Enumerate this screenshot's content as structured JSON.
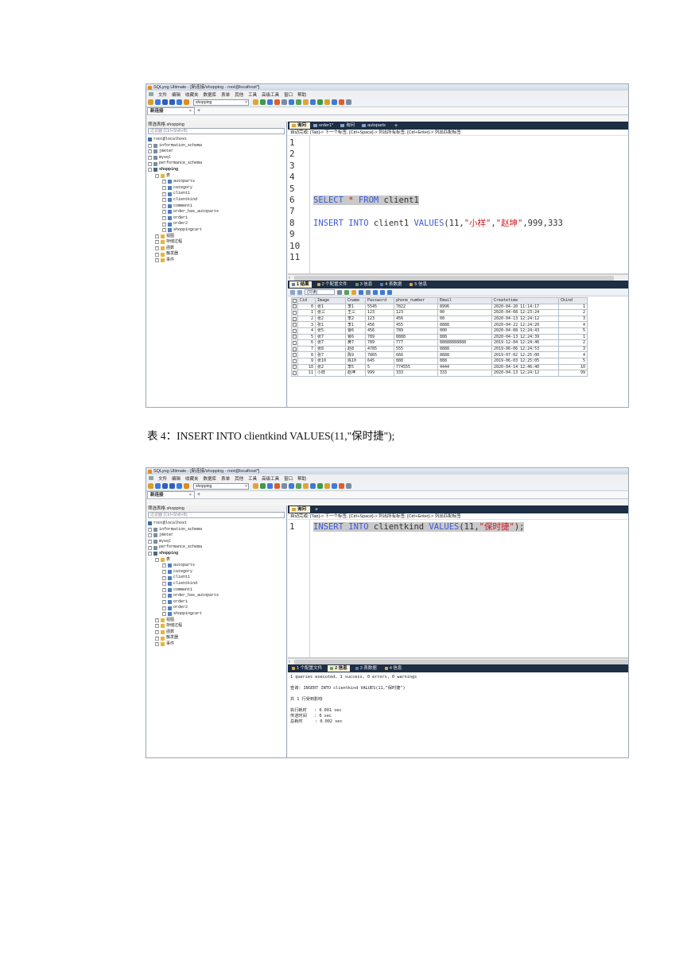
{
  "screens": [
    {
      "window_title": "SQLyog Ultimate - [新连接/shopping - root@localhost*]",
      "menu": [
        "文件",
        "编辑",
        "收藏夹",
        "数据库",
        "表单",
        "其他",
        "工具",
        "高级工具",
        "窗口",
        "帮助"
      ],
      "db_select": "shopping",
      "connection_tab": "新连接",
      "filter_label": "筛选表格 shopping",
      "filter_placeholder": "过滤器 (Ctrl+Shift+B)",
      "tree": [
        {
          "label": "root@localhost",
          "icon": "server-icon",
          "level": 0,
          "exp": ""
        },
        {
          "label": "information_schema",
          "icon": "database-icon",
          "level": 0,
          "exp": "+"
        },
        {
          "label": "jmeter",
          "icon": "database-icon",
          "level": 0,
          "exp": "+"
        },
        {
          "label": "mysql",
          "icon": "database-icon",
          "level": 0,
          "exp": "+"
        },
        {
          "label": "performance_schema",
          "icon": "database-icon",
          "level": 0,
          "exp": "+"
        },
        {
          "label": "shopping",
          "icon": "database-icon",
          "level": 0,
          "exp": "-",
          "bold": true
        },
        {
          "label": "表",
          "icon": "folder-icon",
          "level": 1,
          "exp": "-"
        },
        {
          "label": "autoparts",
          "icon": "table-icon",
          "level": 2,
          "exp": "+"
        },
        {
          "label": "category",
          "icon": "table-icon",
          "level": 2,
          "exp": "+"
        },
        {
          "label": "client1",
          "icon": "table-icon",
          "level": 2,
          "exp": "+"
        },
        {
          "label": "clientkind",
          "icon": "table-icon",
          "level": 2,
          "exp": "+"
        },
        {
          "label": "comment1",
          "icon": "table-icon",
          "level": 2,
          "exp": "+"
        },
        {
          "label": "order_has_autoparts",
          "icon": "table-icon",
          "level": 2,
          "exp": "+"
        },
        {
          "label": "order1",
          "icon": "table-icon",
          "level": 2,
          "exp": "+"
        },
        {
          "label": "order2",
          "icon": "table-icon",
          "level": 2,
          "exp": "+"
        },
        {
          "label": "shoppingcart",
          "icon": "table-icon",
          "level": 2,
          "exp": "+"
        },
        {
          "label": "视图",
          "icon": "folder-icon",
          "level": 1,
          "exp": "+"
        },
        {
          "label": "存储过程",
          "icon": "folder-icon",
          "level": 1,
          "exp": "+"
        },
        {
          "label": "函数",
          "icon": "folder-icon",
          "level": 1,
          "exp": "+"
        },
        {
          "label": "触发器",
          "icon": "folder-icon",
          "level": 1,
          "exp": "+"
        },
        {
          "label": "事件",
          "icon": "folder-icon",
          "level": 1,
          "exp": "+"
        }
      ],
      "query_tabs": [
        {
          "label": "询问",
          "active": true
        },
        {
          "label": "order1*",
          "active": false
        },
        {
          "label": "询问",
          "active": false
        },
        {
          "label": "autoparts",
          "active": false
        }
      ],
      "autocomplete_hint": "自动完成: [Tab]-> 下一个标签, [Ctrl+Space]-> 列出所有标签, [Ctrl+Enter]-> 列出匹配标签",
      "editor_lines": [
        {
          "n": "1",
          "tokens": []
        },
        {
          "n": "2",
          "tokens": []
        },
        {
          "n": "3",
          "tokens": []
        },
        {
          "n": "4",
          "tokens": []
        },
        {
          "n": "5",
          "tokens": []
        },
        {
          "n": "6",
          "tokens": [
            {
              "t": "SELECT",
              "c": "kw",
              "s": true
            },
            {
              "t": " ",
              "c": "plain",
              "s": true
            },
            {
              "t": "*",
              "c": "str",
              "s": true
            },
            {
              "t": " ",
              "c": "plain",
              "s": true
            },
            {
              "t": "FROM",
              "c": "kw",
              "s": true
            },
            {
              "t": " client1",
              "c": "plain",
              "s": true
            }
          ]
        },
        {
          "n": "7",
          "tokens": []
        },
        {
          "n": "8",
          "tokens": [
            {
              "t": "INSERT",
              "c": "kw"
            },
            {
              "t": " ",
              "c": "plain"
            },
            {
              "t": "INTO",
              "c": "kw"
            },
            {
              "t": " client1 ",
              "c": "plain"
            },
            {
              "t": "VALUES",
              "c": "kw"
            },
            {
              "t": "(11,",
              "c": "plain"
            },
            {
              "t": "\"小样\"",
              "c": "str"
            },
            {
              "t": ",",
              "c": "plain"
            },
            {
              "t": "\"赵坤\"",
              "c": "str"
            },
            {
              "t": ",999,333",
              "c": "plain"
            }
          ]
        },
        {
          "n": "9",
          "tokens": []
        },
        {
          "n": "10",
          "tokens": []
        },
        {
          "n": "11",
          "tokens": []
        }
      ],
      "result_tabs": [
        {
          "label": "1 结果",
          "active": true,
          "color": "#4f7fbf"
        },
        {
          "label": "2 个配置文件",
          "active": false,
          "color": "#e0a43a"
        },
        {
          "label": "3 信息",
          "active": false,
          "color": "#5aa05a"
        },
        {
          "label": "4 表数据",
          "active": false,
          "color": "#4f7fbf"
        },
        {
          "label": "5 信息",
          "active": false,
          "color": "#e0a43a"
        }
      ],
      "grid_select": "(只读)",
      "columns": [
        "Cid",
        "Image",
        "Cname",
        "Password",
        "phone_number",
        "Email",
        "Createtime",
        "Ckind"
      ],
      "rows": [
        [
          "0",
          "张1",
          "李1",
          "5545",
          "7822",
          "8996",
          "2020-04-20 11:14:17",
          "1"
        ],
        [
          "1",
          "张三",
          "王三",
          "123",
          "123",
          "00",
          "2020-04-08 12:23:24",
          "2"
        ],
        [
          "2",
          "张2",
          "李2",
          "123",
          "456",
          "00",
          "2020-04-13 12:24:12",
          "3"
        ],
        [
          "3",
          "张1",
          "李1",
          "456",
          "455",
          "8888",
          "2020-04-22 12:24:20",
          "4"
        ],
        [
          "4",
          "张5",
          "曹6",
          "456",
          "789",
          "000",
          "2020-04-08 12:24:43",
          "5"
        ],
        [
          "5",
          "张7",
          "曹6",
          "789",
          "8888",
          "888",
          "2020-04-13 12:24:39",
          "1"
        ],
        [
          "6",
          "张7",
          "黄7",
          "789",
          "777",
          "88888888888",
          "2019-12-04 12:24:46",
          "2"
        ],
        [
          "7",
          "张8",
          "赵8",
          "4785",
          "555",
          "8888",
          "2019-06-06 12:24:53",
          "3"
        ],
        [
          "8",
          "张7",
          "陈9",
          "7865",
          "666",
          "8888",
          "2019-07-02 12:25:00",
          "4"
        ],
        [
          "9",
          "张10",
          "陈10",
          "645",
          "888",
          "888",
          "2019-06-03 12:25:05",
          "5"
        ],
        [
          "10",
          "张2",
          "李5",
          "5",
          "774555",
          "4444",
          "2020-04-14 12:46:40",
          "10"
        ],
        [
          "11",
          "小样",
          "赵坤",
          "999",
          "333",
          "333",
          "2020-04-13 12:24:12",
          "99"
        ]
      ]
    },
    {
      "window_title": "SQLyog Ultimate - [新连接/shopping - root@localhost*]",
      "menu": [
        "文件",
        "编辑",
        "收藏夹",
        "数据库",
        "表单",
        "其他",
        "工具",
        "高级工具",
        "窗口",
        "帮助"
      ],
      "db_select": "shopping",
      "connection_tab": "新连接",
      "filter_label": "筛选表格 shopping",
      "filter_placeholder": "过滤器 (Ctrl+Shift+B)",
      "tree": [
        {
          "label": "root@localhost",
          "icon": "server-icon",
          "level": 0,
          "exp": ""
        },
        {
          "label": "information_schema",
          "icon": "database-icon",
          "level": 0,
          "exp": "+"
        },
        {
          "label": "jmeter",
          "icon": "database-icon",
          "level": 0,
          "exp": "+"
        },
        {
          "label": "mysql",
          "icon": "database-icon",
          "level": 0,
          "exp": "+"
        },
        {
          "label": "performance_schema",
          "icon": "database-icon",
          "level": 0,
          "exp": "+"
        },
        {
          "label": "shopping",
          "icon": "database-icon",
          "level": 0,
          "exp": "-",
          "bold": true
        },
        {
          "label": "表",
          "icon": "folder-icon",
          "level": 1,
          "exp": "-"
        },
        {
          "label": "autoparts",
          "icon": "table-icon",
          "level": 2,
          "exp": "+"
        },
        {
          "label": "category",
          "icon": "table-icon",
          "level": 2,
          "exp": "+"
        },
        {
          "label": "client1",
          "icon": "table-icon",
          "level": 2,
          "exp": "+"
        },
        {
          "label": "clientkind",
          "icon": "table-icon",
          "level": 2,
          "exp": "+"
        },
        {
          "label": "comment1",
          "icon": "table-icon",
          "level": 2,
          "exp": "+"
        },
        {
          "label": "order_has_autoparts",
          "icon": "table-icon",
          "level": 2,
          "exp": "+"
        },
        {
          "label": "order1",
          "icon": "table-icon",
          "level": 2,
          "exp": "+"
        },
        {
          "label": "order2",
          "icon": "table-icon",
          "level": 2,
          "exp": "+"
        },
        {
          "label": "shoppingcart",
          "icon": "table-icon",
          "level": 2,
          "exp": "+"
        },
        {
          "label": "视图",
          "icon": "folder-icon",
          "level": 1,
          "exp": "+"
        },
        {
          "label": "存储过程",
          "icon": "folder-icon",
          "level": 1,
          "exp": "+"
        },
        {
          "label": "函数",
          "icon": "folder-icon",
          "level": 1,
          "exp": "+"
        },
        {
          "label": "触发器",
          "icon": "folder-icon",
          "level": 1,
          "exp": "+"
        },
        {
          "label": "事件",
          "icon": "folder-icon",
          "level": 1,
          "exp": "+"
        }
      ],
      "query_tabs": [
        {
          "label": "询问",
          "active": true
        }
      ],
      "autocomplete_hint": "自动完成: [Tab]-> 下一个标签, [Ctrl+Space]-> 列出所有标签, [Ctrl+Enter]-> 列出匹配标签",
      "editor_lines": [
        {
          "n": "1",
          "tokens": [
            {
              "t": "INSERT",
              "c": "kw",
              "s": true
            },
            {
              "t": " ",
              "c": "plain",
              "s": true
            },
            {
              "t": "INTO",
              "c": "kw",
              "s": true
            },
            {
              "t": " clientkind ",
              "c": "plain",
              "s": true
            },
            {
              "t": "VALUES",
              "c": "kw",
              "s": true
            },
            {
              "t": "(11,",
              "c": "plain",
              "s": true
            },
            {
              "t": "\"保时捷\"",
              "c": "str",
              "s": true
            },
            {
              "t": ");",
              "c": "plain",
              "s": true
            }
          ]
        }
      ],
      "result_tabs": [
        {
          "label": "1 个配置文件",
          "active": false,
          "color": "#e0a43a"
        },
        {
          "label": "2 信息",
          "active": true,
          "color": "#5aa05a"
        },
        {
          "label": "3 表数据",
          "active": false,
          "color": "#4f7fbf"
        },
        {
          "label": "4 信息",
          "active": false,
          "color": "#e0a43a"
        }
      ],
      "messages": "1 queries executed, 1 success, 0 errors, 0 warnings\n\n查询: INSERT INTO clientkind VALUES(11,\"保时捷\")\n\n共 1 行受到影响\n\n执行耗时   : 0.001 sec\n传送时间   : 0 sec\n总耗时     : 0.002 sec"
    }
  ],
  "caption": "表 4：INSERT INTO clientkind VALUES(11,\"保时捷\");",
  "colors": {
    "tab_bar": "#1d2e45",
    "active_tab": "#f8f0d6",
    "keyword": "#3b5bd6",
    "string": "#d0191d"
  }
}
